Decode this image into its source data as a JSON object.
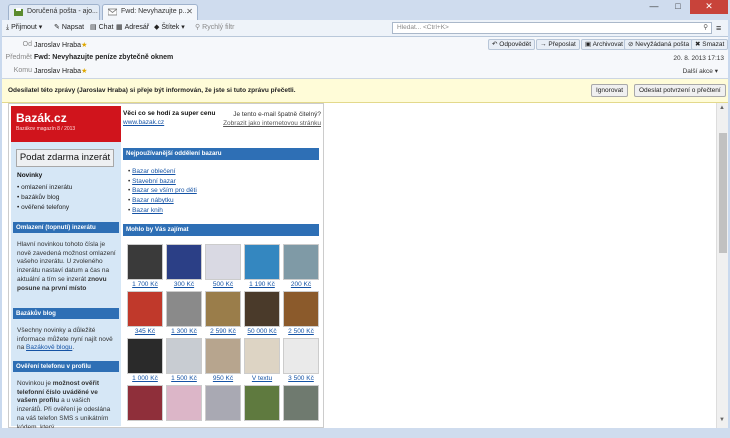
{
  "tabs": [
    {
      "label": "Doručená pošta - ajo...",
      "active": false
    },
    {
      "label": "Fwd: Nevyhazujte p...",
      "active": true
    }
  ],
  "window_controls": {
    "minimize": "—",
    "maximize": "□",
    "close": "✕"
  },
  "toolbar": {
    "receive": "Přijmout",
    "write": "Napsat",
    "chat": "Chat",
    "addressbook": "Adresář",
    "tag": "Štítek",
    "quick_filter": "Rychlý filtr",
    "search_placeholder": "Hledat... <Ctrl+K>"
  },
  "message": {
    "from_label": "Od",
    "from_value": "Jaroslav Hraba",
    "subject_label": "Předmět",
    "subject_value": "Fwd: Nevyhazujte peníze zbytečně oknem",
    "to_label": "Komu",
    "to_value": "Jaroslav Hraba",
    "date": "20. 8. 2013 17:13",
    "more_actions": "Další akce",
    "actions": {
      "reply": "Odpovědět",
      "forward": "Přeposlat",
      "archive": "Archivovat",
      "junk": "Nevyžádaná pošta",
      "delete": "Smazat"
    }
  },
  "notice": {
    "text": "Odesílatel této zprávy (Jaroslav Hraba) si přeje být informován, že jste si tuto zprávu přečetli.",
    "ignore": "Ignorovat",
    "send_receipt": "Odeslat potvrzení o přečtení"
  },
  "email": {
    "logo_title": "Bazák.cz",
    "logo_subtitle": "Bazákov magazín   8 / 2013",
    "cta": "Podat zdarma inzerát",
    "news_label": "Novinky",
    "news_items": [
      "omlazení inzerátu",
      "bazákův blog",
      "ověřené telefony"
    ],
    "sec1_title": "Omlazení (topnutí) inzerátu",
    "sec1_text_a": "Hlavní novinkou tohoto čísla je nově zavedená možnost omlazení vašeho inzerátu. U zvoleného inzerátu nastaví datum a čas na aktuální a tím se inzerát ",
    "sec1_text_bold": "znovu posune na první místo",
    "sec2_title": "Bazákův blog",
    "sec2_text": "Všechny novinky a důležité informace můžete nyní najít nově na ",
    "sec2_link": "Bazákově blogu",
    "sec3_title": "Ověření telefonu v profilu",
    "sec3_text_a": "Novinkou je ",
    "sec3_text_bold": "možnost ověřit telefonní číslo uváděné ve vašem profilu",
    "sec3_text_b": " a u vašich inzerátů. Při ověření je odeslána na váš telefon SMS s unikátním kódem, který",
    "promo_title": "Věci co se hodí za super cenu",
    "promo_link": "www.bazak.cz",
    "promo_right_a": "Je tento e-mail špatně čitelný?",
    "promo_right_link": "Zobrazit jako internetovou stránku",
    "popular_title": "Nejpoužívanější oddělení bazaru",
    "categories": [
      "Bazar oblečení",
      "Stavební bazar",
      "Bazar se vším pro děti",
      "Bazar nábytku",
      "Bazar knih"
    ],
    "interest_title": "Mohlo by Vás zajímat",
    "products": [
      {
        "price": "1 700 Kč",
        "color": "#3a3a3a"
      },
      {
        "price": "300 Kč",
        "color": "#2b3f86"
      },
      {
        "price": "500 Kč",
        "color": "#d9d9e3"
      },
      {
        "price": "1 190 Kč",
        "color": "#3487c0"
      },
      {
        "price": "200 Kč",
        "color": "#7f9aa6"
      },
      {
        "price": "345 Kč",
        "color": "#c0392b"
      },
      {
        "price": "1 300 Kč",
        "color": "#8a8a8a"
      },
      {
        "price": "2 590 Kč",
        "color": "#9a7d4a"
      },
      {
        "price": "50 000 Kč",
        "color": "#4a3a2a"
      },
      {
        "price": "2 500 Kč",
        "color": "#8b5a2b"
      },
      {
        "price": "1 000 Kč",
        "color": "#2a2a2a"
      },
      {
        "price": "1 500 Kč",
        "color": "#c8ccd2"
      },
      {
        "price": "950 Kč",
        "color": "#b7a58e"
      },
      {
        "price": "V textu",
        "color": "#ddd4c4"
      },
      {
        "price": "3 500 Kč",
        "color": "#eaeaea"
      },
      {
        "price": "",
        "color": "#8f2f3a"
      },
      {
        "price": "",
        "color": "#dcb6c8"
      },
      {
        "price": "",
        "color": "#a9a9b3"
      },
      {
        "price": "",
        "color": "#5f7a3f"
      },
      {
        "price": "",
        "color": "#6f7a6f"
      }
    ]
  }
}
